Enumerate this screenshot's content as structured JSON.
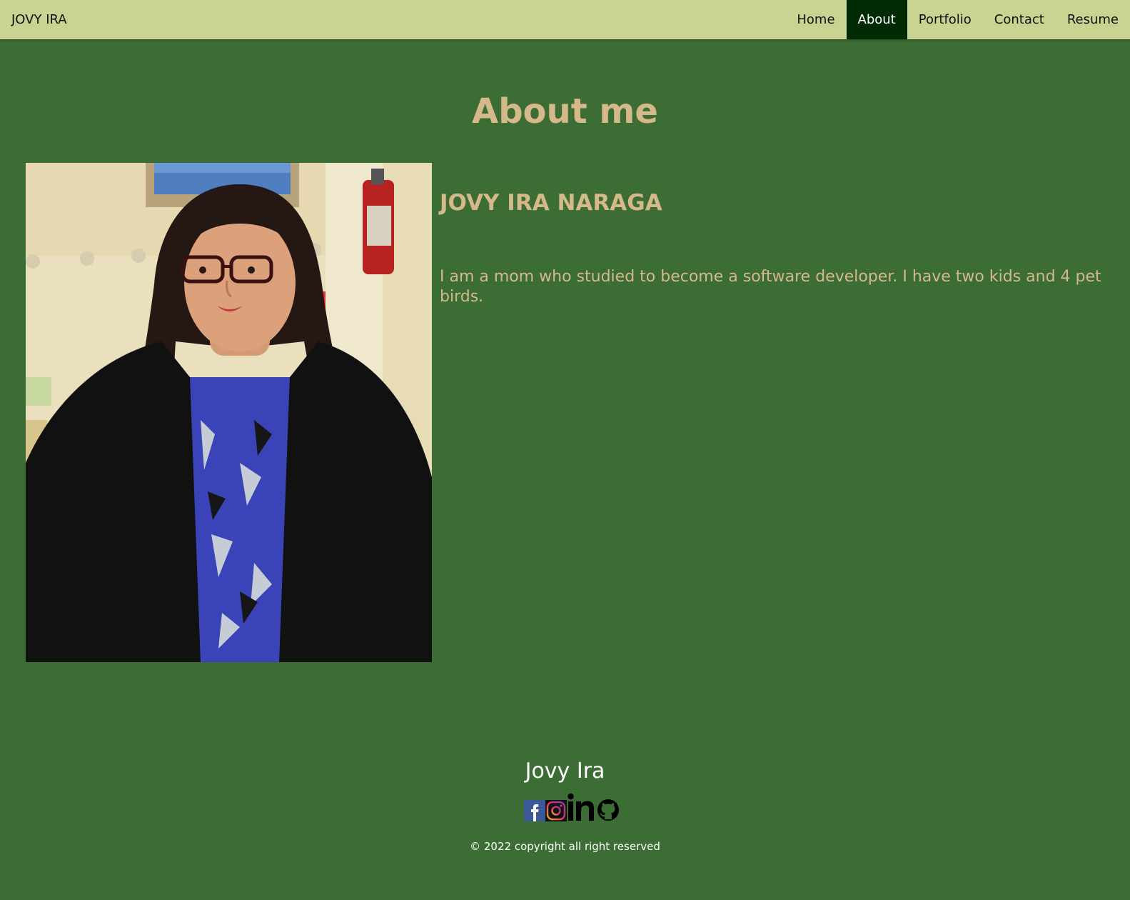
{
  "header": {
    "brand": "JOVY IRA",
    "nav": [
      "Home",
      "About",
      "Portfolio",
      "Contact",
      "Resume"
    ],
    "active": "About"
  },
  "about": {
    "title": "About me",
    "photo_alt": "Photo of Jovy Ira Naraga",
    "name": "JOVY IRA NARAGA",
    "bio": "I am a mom who studied to become a software developer. I have two kids and 4 pet birds."
  },
  "footer": {
    "name": "Jovy Ira",
    "social_icons": [
      "facebook-icon",
      "instagram-icon",
      "linkedin-icon",
      "github-icon"
    ],
    "copyright": "© 2022 copyright all right reserved"
  },
  "colors": {
    "page_bg": "#3b6d34",
    "nav_bg": "#cbd393",
    "nav_active_bg": "#002a04",
    "accent_text": "#d6b98a"
  }
}
